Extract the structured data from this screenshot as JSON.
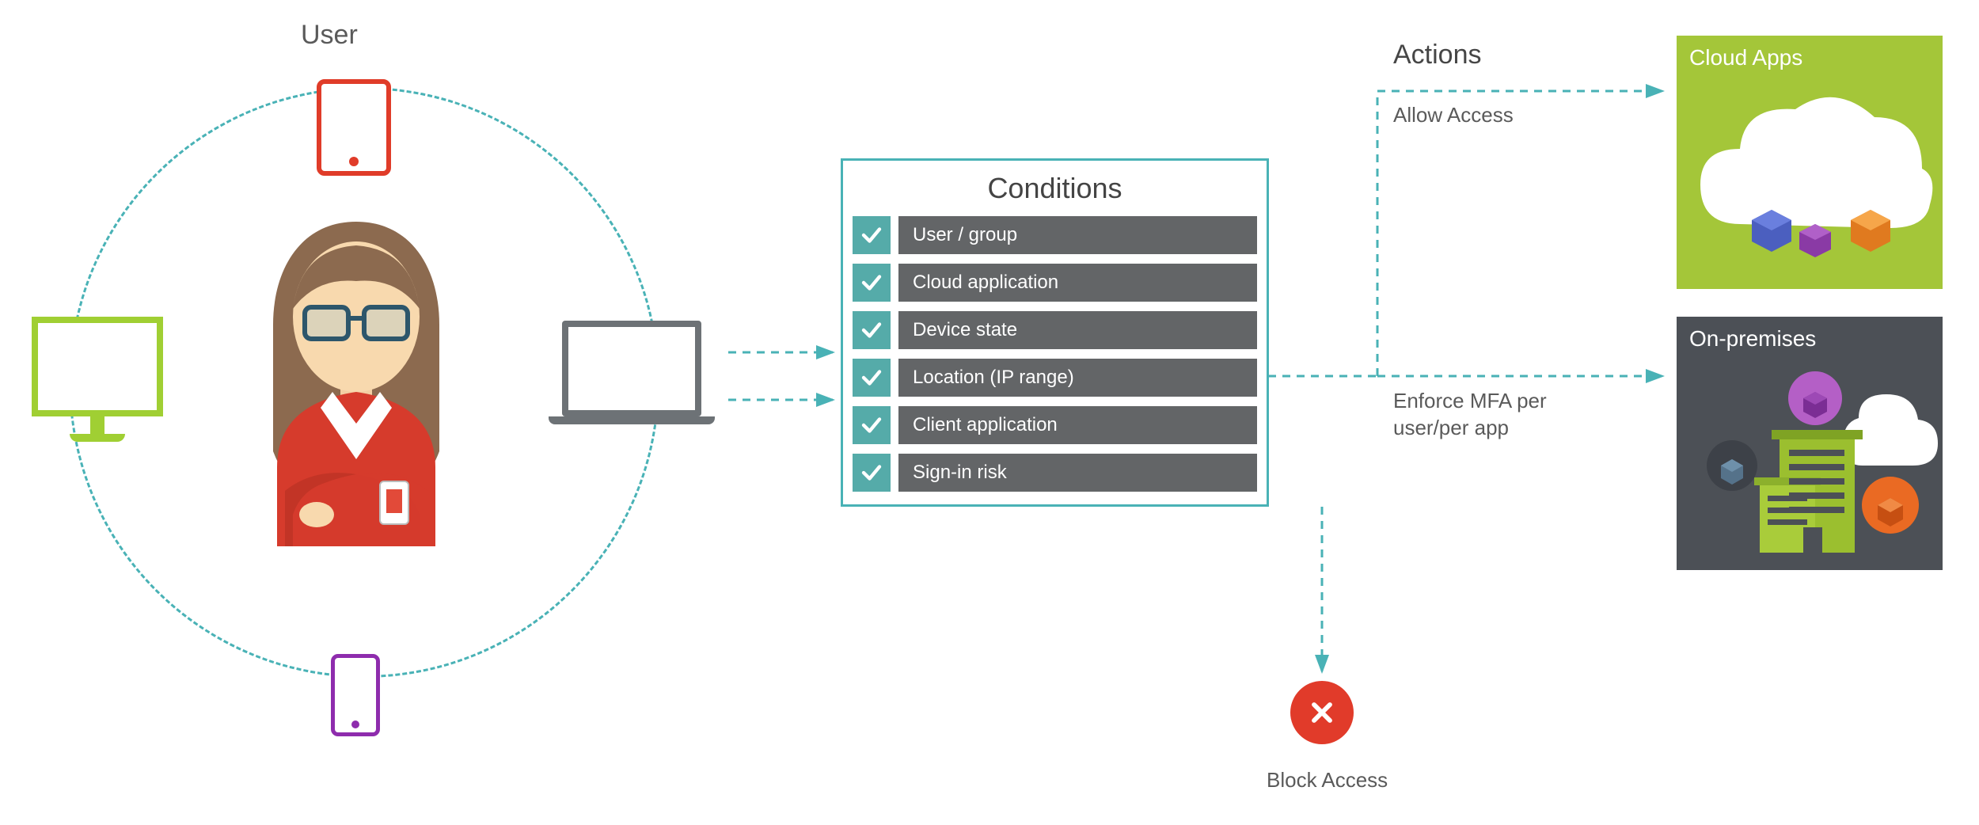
{
  "labels": {
    "user": "User",
    "conditions_title": "Conditions",
    "actions_title": "Actions",
    "allow_access": "Allow Access",
    "enforce_mfa": "Enforce MFA per user/per app",
    "block_access": "Block Access",
    "cloud_apps": "Cloud Apps",
    "on_premises": "On-premises"
  },
  "conditions": [
    "User / group",
    "Cloud application",
    "Device state",
    "Location (IP range)",
    "Client application",
    "Sign-in risk"
  ],
  "colors": {
    "teal": "#49b2b6",
    "teal_fill": "#55aba9",
    "gray_bar": "#636567",
    "red": "#e13b2a",
    "green_tile": "#a4c639",
    "dark_tile": "#4c5056",
    "lime": "#a0cf33",
    "orange_red": "#e03c29",
    "purple": "#8e2cad",
    "laptop_gray": "#6d7276"
  }
}
